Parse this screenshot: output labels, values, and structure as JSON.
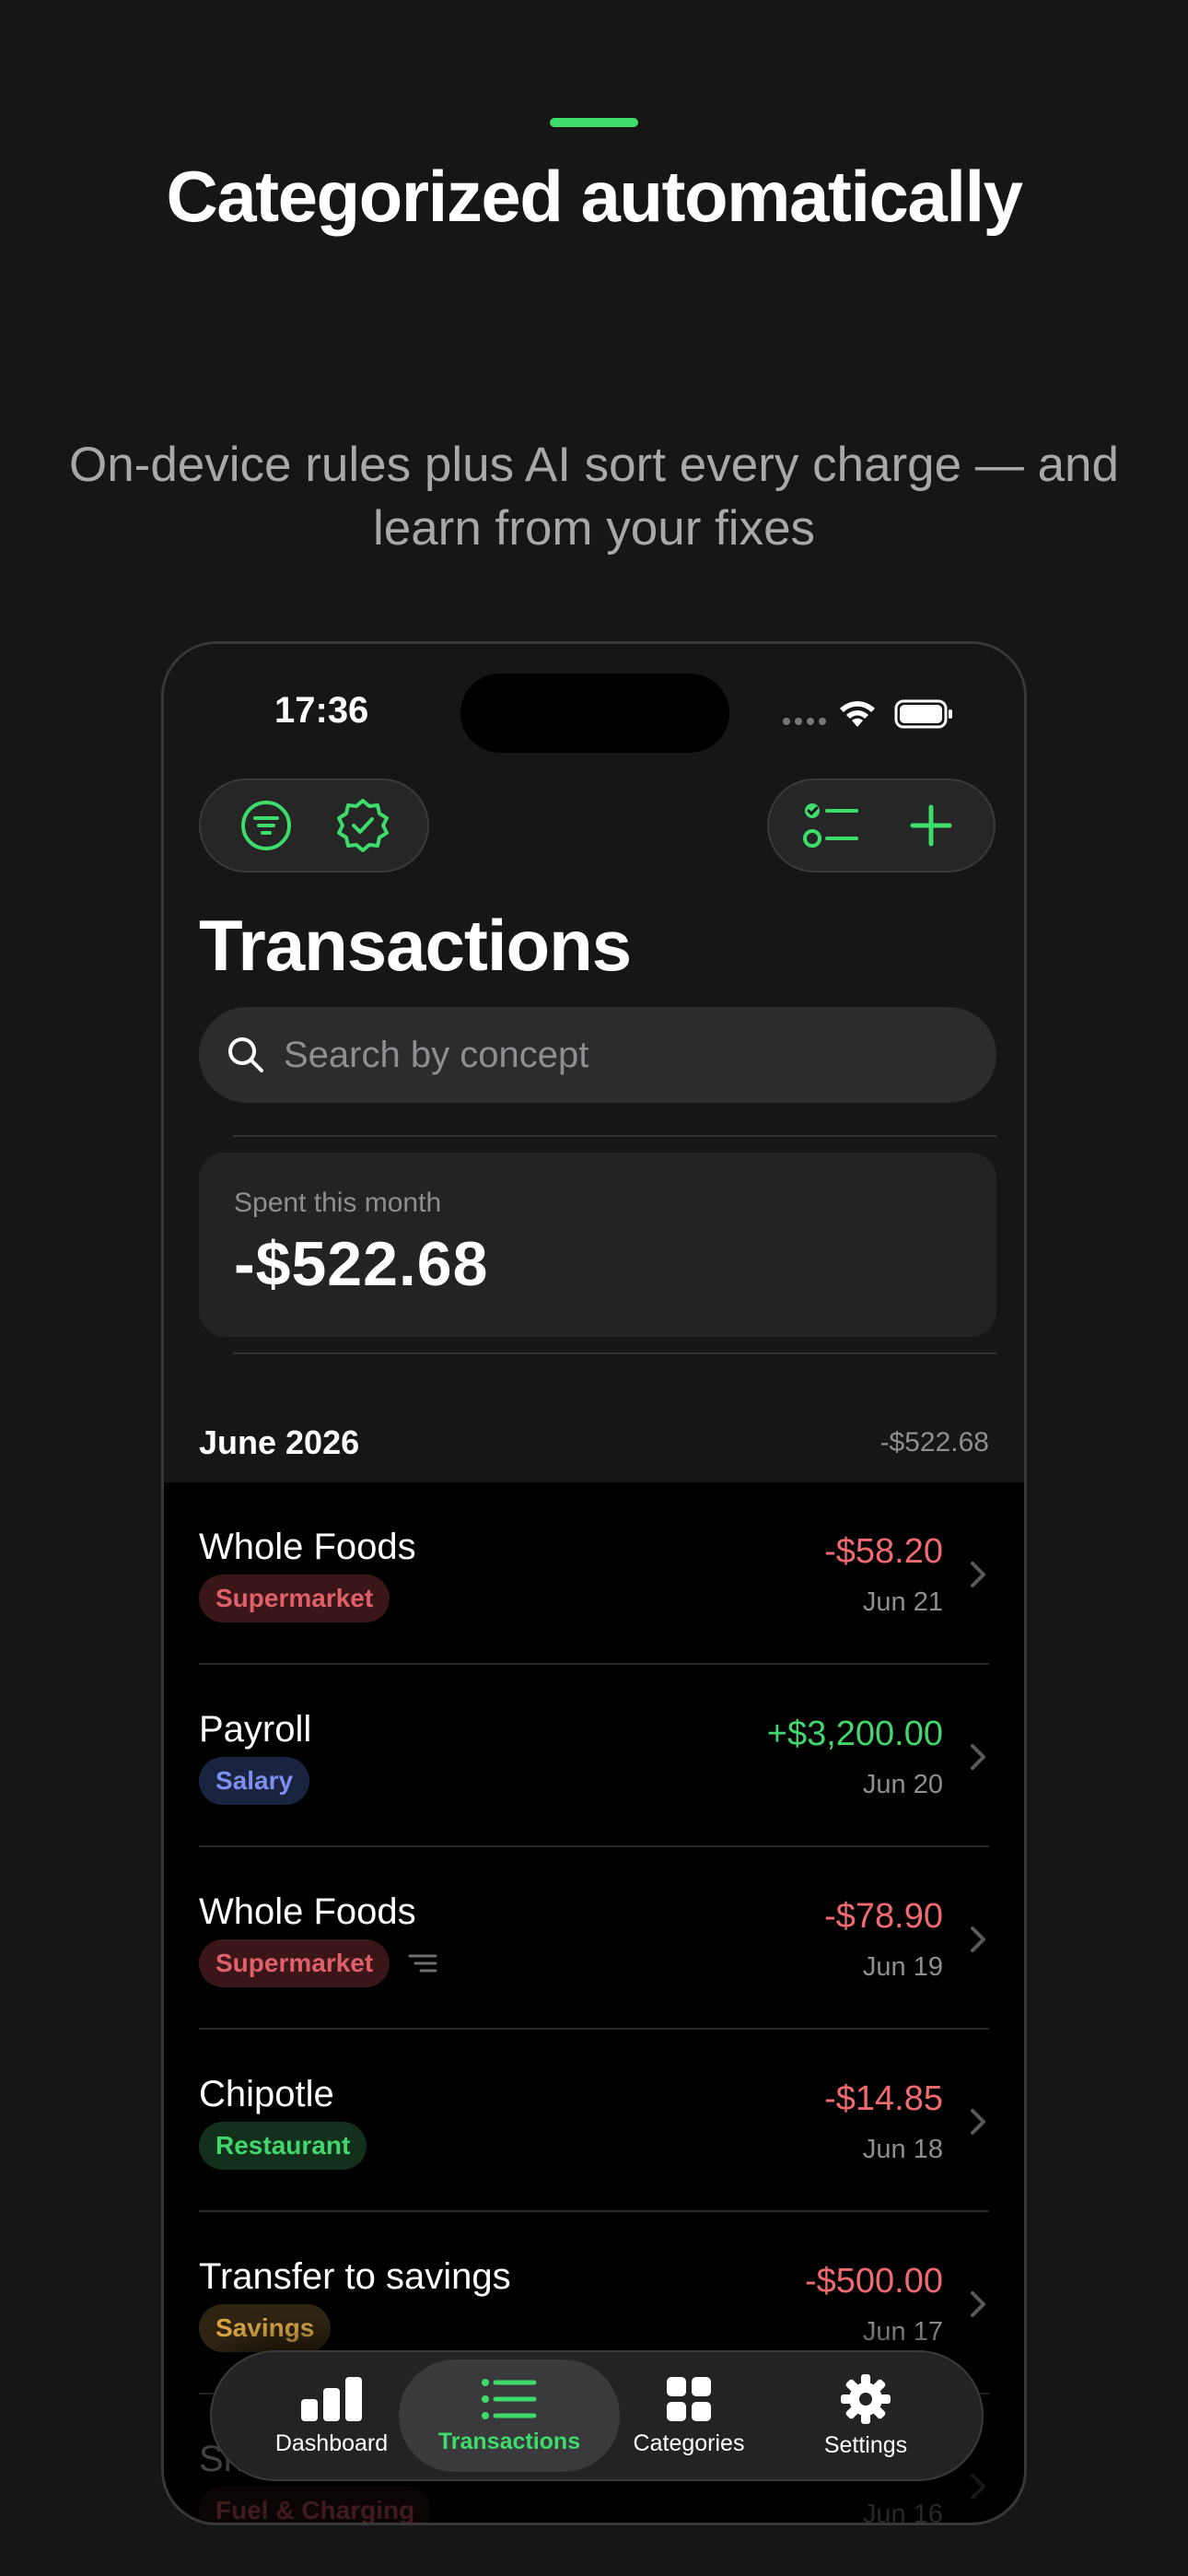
{
  "marketing": {
    "headline": "Categorized automatically",
    "subhead": "On-device rules plus AI sort every charge — and learn from your fixes"
  },
  "status_bar": {
    "time": "17:36"
  },
  "page": {
    "title": "Transactions"
  },
  "search": {
    "placeholder": "Search by concept"
  },
  "summary": {
    "label": "Spent this month",
    "value": "-$522.68"
  },
  "section": {
    "month": "June 2026",
    "total": "-$522.68"
  },
  "transactions": [
    {
      "name": "Whole Foods",
      "category": "Supermarket",
      "amount": "-$58.20",
      "date": "Jun 21"
    },
    {
      "name": "Payroll",
      "category": "Salary",
      "amount": "+$3,200.00",
      "date": "Jun 20"
    },
    {
      "name": "Whole Foods",
      "category": "Supermarket",
      "amount": "-$78.90",
      "date": "Jun 19"
    },
    {
      "name": "Chipotle",
      "category": "Restaurant",
      "amount": "-$14.85",
      "date": "Jun 18"
    },
    {
      "name": "Transfer to savings",
      "category": "Savings",
      "amount": "-$500.00",
      "date": "Jun 17"
    },
    {
      "name": "Sh",
      "category": "Fuel & Charging",
      "amount": "",
      "date": "Jun 16"
    }
  ],
  "tabs": [
    {
      "label": "Dashboard",
      "icon": "bar-chart-icon"
    },
    {
      "label": "Transactions",
      "icon": "list-icon",
      "active": true
    },
    {
      "label": "Categories",
      "icon": "grid-icon"
    },
    {
      "label": "Settings",
      "icon": "gear-icon"
    }
  ],
  "colors": {
    "accent": "#3ddc6b",
    "expense": "#f06a70",
    "income": "#42d66c",
    "background": "#161616"
  }
}
